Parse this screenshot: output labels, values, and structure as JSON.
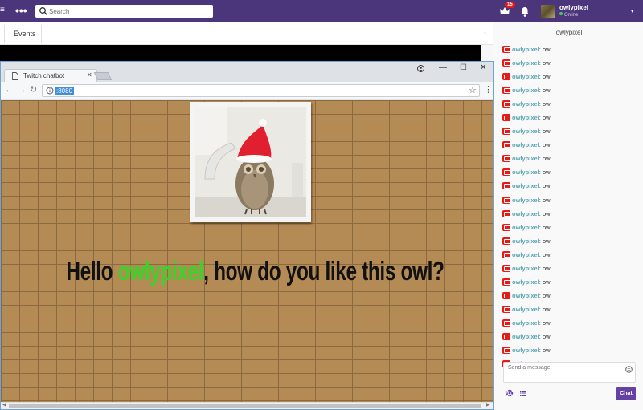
{
  "topnav": {
    "search_placeholder": "Search",
    "notifications_count": "15",
    "username": "owlypixel",
    "status": "Online"
  },
  "events_tab": "Events",
  "browser": {
    "tab_title": "Twitch chatbot",
    "url": ":8080"
  },
  "page": {
    "greeting_prefix": "Hello ",
    "greeting_user": "owlypixel",
    "greeting_suffix": ", how do you like this owl?"
  },
  "chat": {
    "channel": "owlypixel",
    "messages": [
      {
        "name": "owlypixel",
        "text": "owl"
      },
      {
        "name": "owlypixel",
        "text": "owl"
      },
      {
        "name": "owlypixel",
        "text": "owl"
      },
      {
        "name": "owlypixel",
        "text": "owl"
      },
      {
        "name": "owlypixel",
        "text": "owl"
      },
      {
        "name": "owlypixel",
        "text": "owl"
      },
      {
        "name": "owlypixel",
        "text": "owl"
      },
      {
        "name": "owlypixel",
        "text": "owl"
      },
      {
        "name": "owlypixel",
        "text": "owl"
      },
      {
        "name": "owlypixel",
        "text": "owl"
      },
      {
        "name": "owlypixel",
        "text": "owl"
      },
      {
        "name": "owlypixel",
        "text": "owl"
      },
      {
        "name": "owlypixel",
        "text": "owl"
      },
      {
        "name": "owlypixel",
        "text": "owl"
      },
      {
        "name": "owlypixel",
        "text": "owl"
      },
      {
        "name": "owlypixel",
        "text": "owl"
      },
      {
        "name": "owlypixel",
        "text": "owl"
      },
      {
        "name": "owlypixel",
        "text": "owl"
      },
      {
        "name": "owlypixel",
        "text": "owl"
      },
      {
        "name": "owlypixel",
        "text": "owl"
      },
      {
        "name": "owlypixel",
        "text": "owl"
      },
      {
        "name": "owlypixel",
        "text": "owl"
      },
      {
        "name": "owlypixel",
        "text": "owl"
      },
      {
        "name": "owlypixel",
        "text": "owl"
      }
    ],
    "input_placeholder": "Send a message",
    "send_label": "Chat"
  },
  "colors": {
    "twitch_purple": "#4b367c",
    "button_purple": "#6441a4",
    "username_green": "#3ad428",
    "chat_name": "#5aa7b3",
    "brick": "#b48a55"
  },
  "icons": [
    "menu-icon",
    "more-icon",
    "search-icon",
    "crown-icon",
    "bell-icon",
    "dropdown-caret-icon",
    "document-icon",
    "close-icon",
    "back-icon",
    "forward-icon",
    "reload-icon",
    "info-icon",
    "star-icon",
    "kebab-icon",
    "moderator-badge-icon",
    "emoji-icon",
    "gear-icon",
    "list-icon"
  ]
}
